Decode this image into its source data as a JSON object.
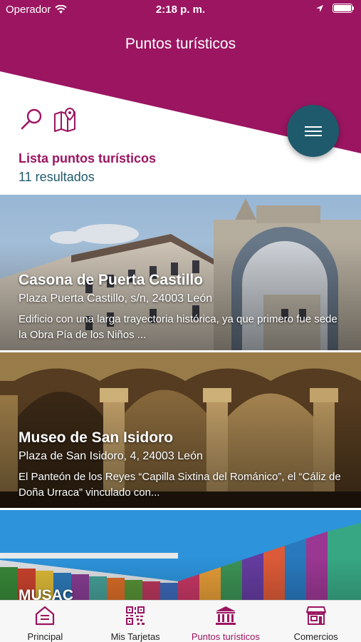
{
  "status_bar": {
    "carrier": "Operador",
    "time": "2:18 p. m."
  },
  "header": {
    "title": "Puntos turísticos"
  },
  "toolbar": {
    "search_icon": "search-icon",
    "map_icon": "map-icon",
    "menu_icon": "hamburger-menu-icon"
  },
  "list": {
    "title": "Lista puntos turísticos",
    "count": "11 resultados"
  },
  "cards": [
    {
      "name": "Casona de Puerta Castillo",
      "address": "Plaza Puerta Castillo, s/n, 24003 León",
      "description": "Edificio con una larga trayectoria histórica, ya que primero fue sede la Obra Pía de los Niños ..."
    },
    {
      "name": "Museo de San Isidoro",
      "address": "Plaza de San Isidoro, 4, 24003 León",
      "description": "El Panteón de los Reyes “Capilla Sixtina del Románico”, el “Cáliz de Doña Urraca” vinculado con..."
    },
    {
      "name": "MUSAC",
      "address": "",
      "description": ""
    }
  ],
  "tabs": [
    {
      "label": "Principal",
      "icon": "principal-icon",
      "active": false
    },
    {
      "label": "Mis Tarjetas",
      "icon": "qr-code-icon",
      "active": false
    },
    {
      "label": "Puntos turísticos",
      "icon": "museum-icon",
      "active": true
    },
    {
      "label": "Comercios",
      "icon": "store-icon",
      "active": false
    }
  ],
  "colors": {
    "brand": "#9b1561",
    "accent": "#1f5a6c",
    "tab_bar": "#f7f7f7"
  }
}
